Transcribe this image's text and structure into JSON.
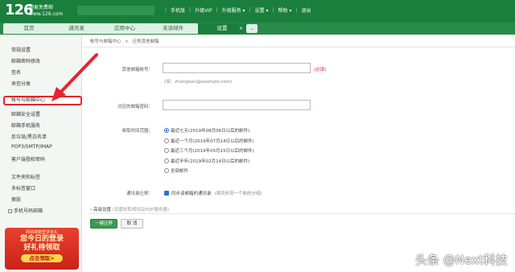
{
  "header": {
    "logo_text": "126",
    "logo_sub_1": "网易免费邮",
    "logo_sub_2": "www.126.com",
    "nav": [
      "手机版",
      "升级VIP",
      "升级服务 ▾",
      "设置 ▾",
      "帮助 ▾",
      "退出"
    ]
  },
  "tabs": [
    {
      "label": "首页"
    },
    {
      "label": "通讯录"
    },
    {
      "label": "应用中心"
    },
    {
      "label": "未读邮件"
    },
    {
      "label": "设置",
      "close": "×"
    }
  ],
  "tab_more": "⌄",
  "sidebar": {
    "group1": [
      "常规设置",
      "邮箱密码修改",
      "签名",
      "来信分类"
    ],
    "active": "帐号与邮箱中心",
    "group2": [
      "邮箱安全设置",
      "邮箱手机服务",
      "反垃圾/黑白名单",
      "POP3/SMTP/IMAP",
      "客户端授权密码"
    ],
    "group3": [
      "文件夹和标签",
      "多标签窗口",
      "换肤"
    ],
    "mobile_item": "手机号码邮箱"
  },
  "promo": {
    "top": "网易邮箱登录有礼",
    "line1": "您今日的登录",
    "line2": "好礼待领取",
    "button": "点击领取>"
  },
  "breadcrumb": {
    "parent": "帐号与邮箱中心",
    "sep": ">",
    "current": "迁移其他邮箱"
  },
  "form": {
    "other_account_label": "其他邮箱帐号：",
    "other_account_value": "",
    "required_mark": "(必填)",
    "account_hint": "(如：zhangsan@example.com)",
    "password_label": "对应的邮箱密码：",
    "password_value": "",
    "range_label": "收取时间范围：",
    "range_options": [
      "最近七天(2019年08月06日以后的邮件)",
      "最近一个月(2019年07月14日以后的邮件)",
      "最近三个月(2019年05月15日以后的邮件)",
      "最近半年(2019年02月14日以后的邮件)",
      "全部邮件"
    ],
    "range_selected": 0,
    "contacts_label": "通讯录迁移：",
    "contacts_check": "同步该邮箱的通讯录",
    "contacts_hint": "(将同步到一个新的分组)",
    "advanced_label": "高级设置",
    "advanced_hint": "(设置收取规则及POP服务器)",
    "ok_button": "一键迁移",
    "cancel_button": "取 消"
  },
  "watermark": "头条 @Next科技",
  "colors": {
    "header_green": "#1a7f3c",
    "highlight_red": "#e5262b",
    "radio_blue": "#2a6fd1"
  }
}
